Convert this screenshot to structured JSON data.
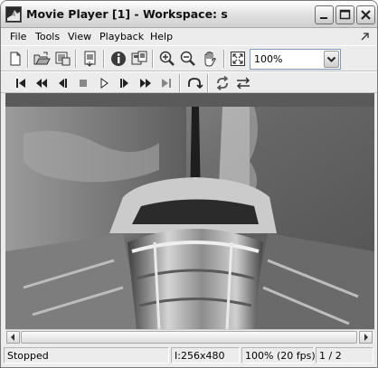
{
  "window": {
    "title": "Movie Player [1] - Workspace: s"
  },
  "menu": {
    "items": [
      "File",
      "Tools",
      "View",
      "Playback",
      "Help"
    ]
  },
  "toolbar": {
    "zoom_value": "100%",
    "icons": [
      "new-icon",
      "open-icon",
      "import-icon",
      "export-icon",
      "info-icon",
      "colormap-icon",
      "zoom-in-icon",
      "zoom-out-icon",
      "pan-hand-icon",
      "fit-window-icon"
    ]
  },
  "playback_toolbar": {
    "icons": [
      "go-to-first-icon",
      "rewind-icon",
      "step-back-icon",
      "stop-icon",
      "play-icon",
      "step-forward-icon",
      "fast-forward-icon",
      "go-to-last-icon",
      "jump-to-icon",
      "repeat-icon",
      "forward-backward-icon"
    ]
  },
  "status": {
    "state": "Stopped",
    "frame_info": "I:256x480",
    "zoom_fps": "100% (20 fps)",
    "frame_counter": "1 / 2"
  }
}
